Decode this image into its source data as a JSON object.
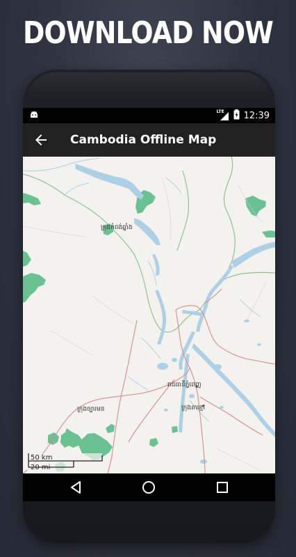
{
  "promo": {
    "headline": "DOWNLOAD NOW"
  },
  "status_bar": {
    "network_label": "LTE",
    "time": "12:39",
    "icons": [
      "android-debug-icon",
      "lte-signal-icon",
      "battery-charging-icon"
    ]
  },
  "app_bar": {
    "back_icon": "arrow-left-icon",
    "title": "Cambodia Offline Map"
  },
  "map": {
    "places": [
      "ក្រុងកំពង់ឆ្នាំង",
      "រាជធានីភ្នំពេញ",
      "ក្រុងតាខ្មៅ",
      "ក្រុងច្បារមន"
    ],
    "scale": {
      "metric": "50 km",
      "imperial": "20 mi"
    },
    "colors": {
      "land": "#f3f2ef",
      "water": "#aed0e6",
      "forest": "#6cc193",
      "major_road": "#d98a8a",
      "admin_boundary": "#8fc28f"
    }
  },
  "nav_bar": {
    "buttons": [
      "back-triangle-icon",
      "home-circle-icon",
      "recents-square-icon"
    ]
  }
}
